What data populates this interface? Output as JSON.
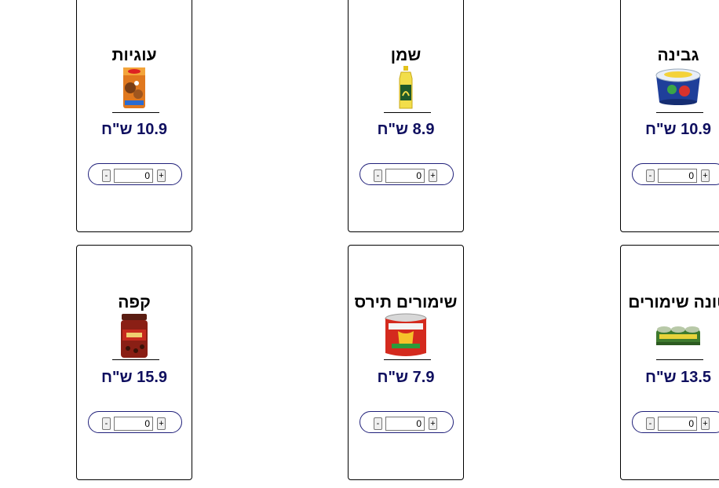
{
  "currency": "ש\"ח",
  "products": [
    {
      "name": "עוגיות",
      "price": "10.9 ש\"ח",
      "quantity": "0",
      "image_icon": "cookies-bag-icon"
    },
    {
      "name": "שמן",
      "price": "8.9 ש\"ח",
      "quantity": "0",
      "image_icon": "oil-bottle-icon"
    },
    {
      "name": "גבינה",
      "price": "10.9 ש\"ח",
      "quantity": "0",
      "image_icon": "cheese-tub-icon"
    },
    {
      "name": "קפה",
      "price": "15.9 ש\"ח",
      "quantity": "0",
      "image_icon": "coffee-jar-icon"
    },
    {
      "name": "שימורים תירס",
      "price": "7.9 ש\"ח",
      "quantity": "0",
      "image_icon": "corn-can-icon"
    },
    {
      "name": "טונה שימורים",
      "price": "13.5 ש\"ח",
      "quantity": "0",
      "image_icon": "tuna-cans-icon"
    }
  ],
  "controls": {
    "minus_label": "-",
    "plus_label": "+"
  },
  "colors": {
    "price_text": "#0f0f5f",
    "quantity_border": "#20207a",
    "card_border": "#000000"
  }
}
